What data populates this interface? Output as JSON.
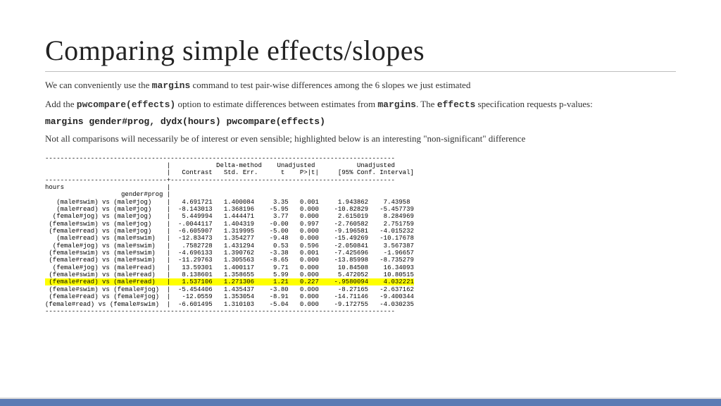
{
  "title": "Comparing simple effects/slopes",
  "para1_a": "We can conveniently use the ",
  "para1_code": "margins",
  "para1_b": " command to test pair-wise differences among the 6 slopes we just estimated",
  "para2_a": "Add the ",
  "para2_code1": "pwcompare(effects)",
  "para2_b": " option to estimate differences between estimates from ",
  "para2_code2": "margins",
  "para2_c": ".  The ",
  "para2_code3": "effects",
  "para2_d": " specification requests p-values:",
  "command": "margins gender#prog, dydx(hours) pwcompare(effects)",
  "para3": "Not all comparisons will necessarily be of interest or even sensible; highlighted below is an interesting \"non-significant\" difference",
  "output_top": "--------------------------------------------------------------------------------------------\n                                |            Delta-method    Unadjusted           Unadjusted\n                                |   Contrast   Std. Err.      t    P>|t|     [95% Conf. Interval]\n--------------------------------+-----------------------------------------------------------\nhours                           |\n                    gender#prog |\n   (male#swim) vs (male#jog)    |   4.691721   1.400084     3.35   0.001     1.943862    7.43958\n   (male#read) vs (male#jog)    |  -8.143013   1.368196    -5.95   0.000    -10.82829   -5.457739\n  (female#jog) vs (male#jog)    |   5.449994   1.444471     3.77   0.000     2.615019    8.284969\n (female#swim) vs (male#jog)    |  -.0044117   1.404319    -0.00   0.997    -2.760582    2.751759\n (female#read) vs (male#jog)    |  -6.605907   1.319995    -5.00   0.000    -9.196581   -4.015232\n   (male#read) vs (male#swim)   |  -12.83473   1.354277    -9.48   0.000    -15.49269   -10.17678\n  (female#jog) vs (male#swim)   |   .7582728   1.431294     0.53   0.596    -2.050841    3.567387\n (female#swim) vs (male#swim)   |  -4.696133   1.390762    -3.38   0.001    -7.425696    -1.96657\n (female#read) vs (male#swim)   |  -11.29763   1.305563    -8.65   0.000    -13.85998   -8.735279\n  (female#jog) vs (male#read)   |   13.59301   1.400117     9.71   0.000     10.84508    16.34093\n (female#swim) vs (male#read)   |   8.138601   1.358655     5.99   0.000     5.472052    10.80515",
  "output_hl": " (female#read) vs (male#read)   |   1.537106   1.271306     1.21   0.227    -.9580094    4.032221",
  "output_bot": " (female#swim) vs (female#jog)  |  -5.454406   1.435437    -3.80   0.000     -8.27165   -2.637162\n (female#read) vs (female#jog)  |   -12.0559   1.353054    -8.91   0.000    -14.71146   -9.400344\n(female#read) vs (female#swim)  |  -6.601495   1.310103    -5.04   0.000    -9.172755   -4.030235\n--------------------------------------------------------------------------------------------"
}
